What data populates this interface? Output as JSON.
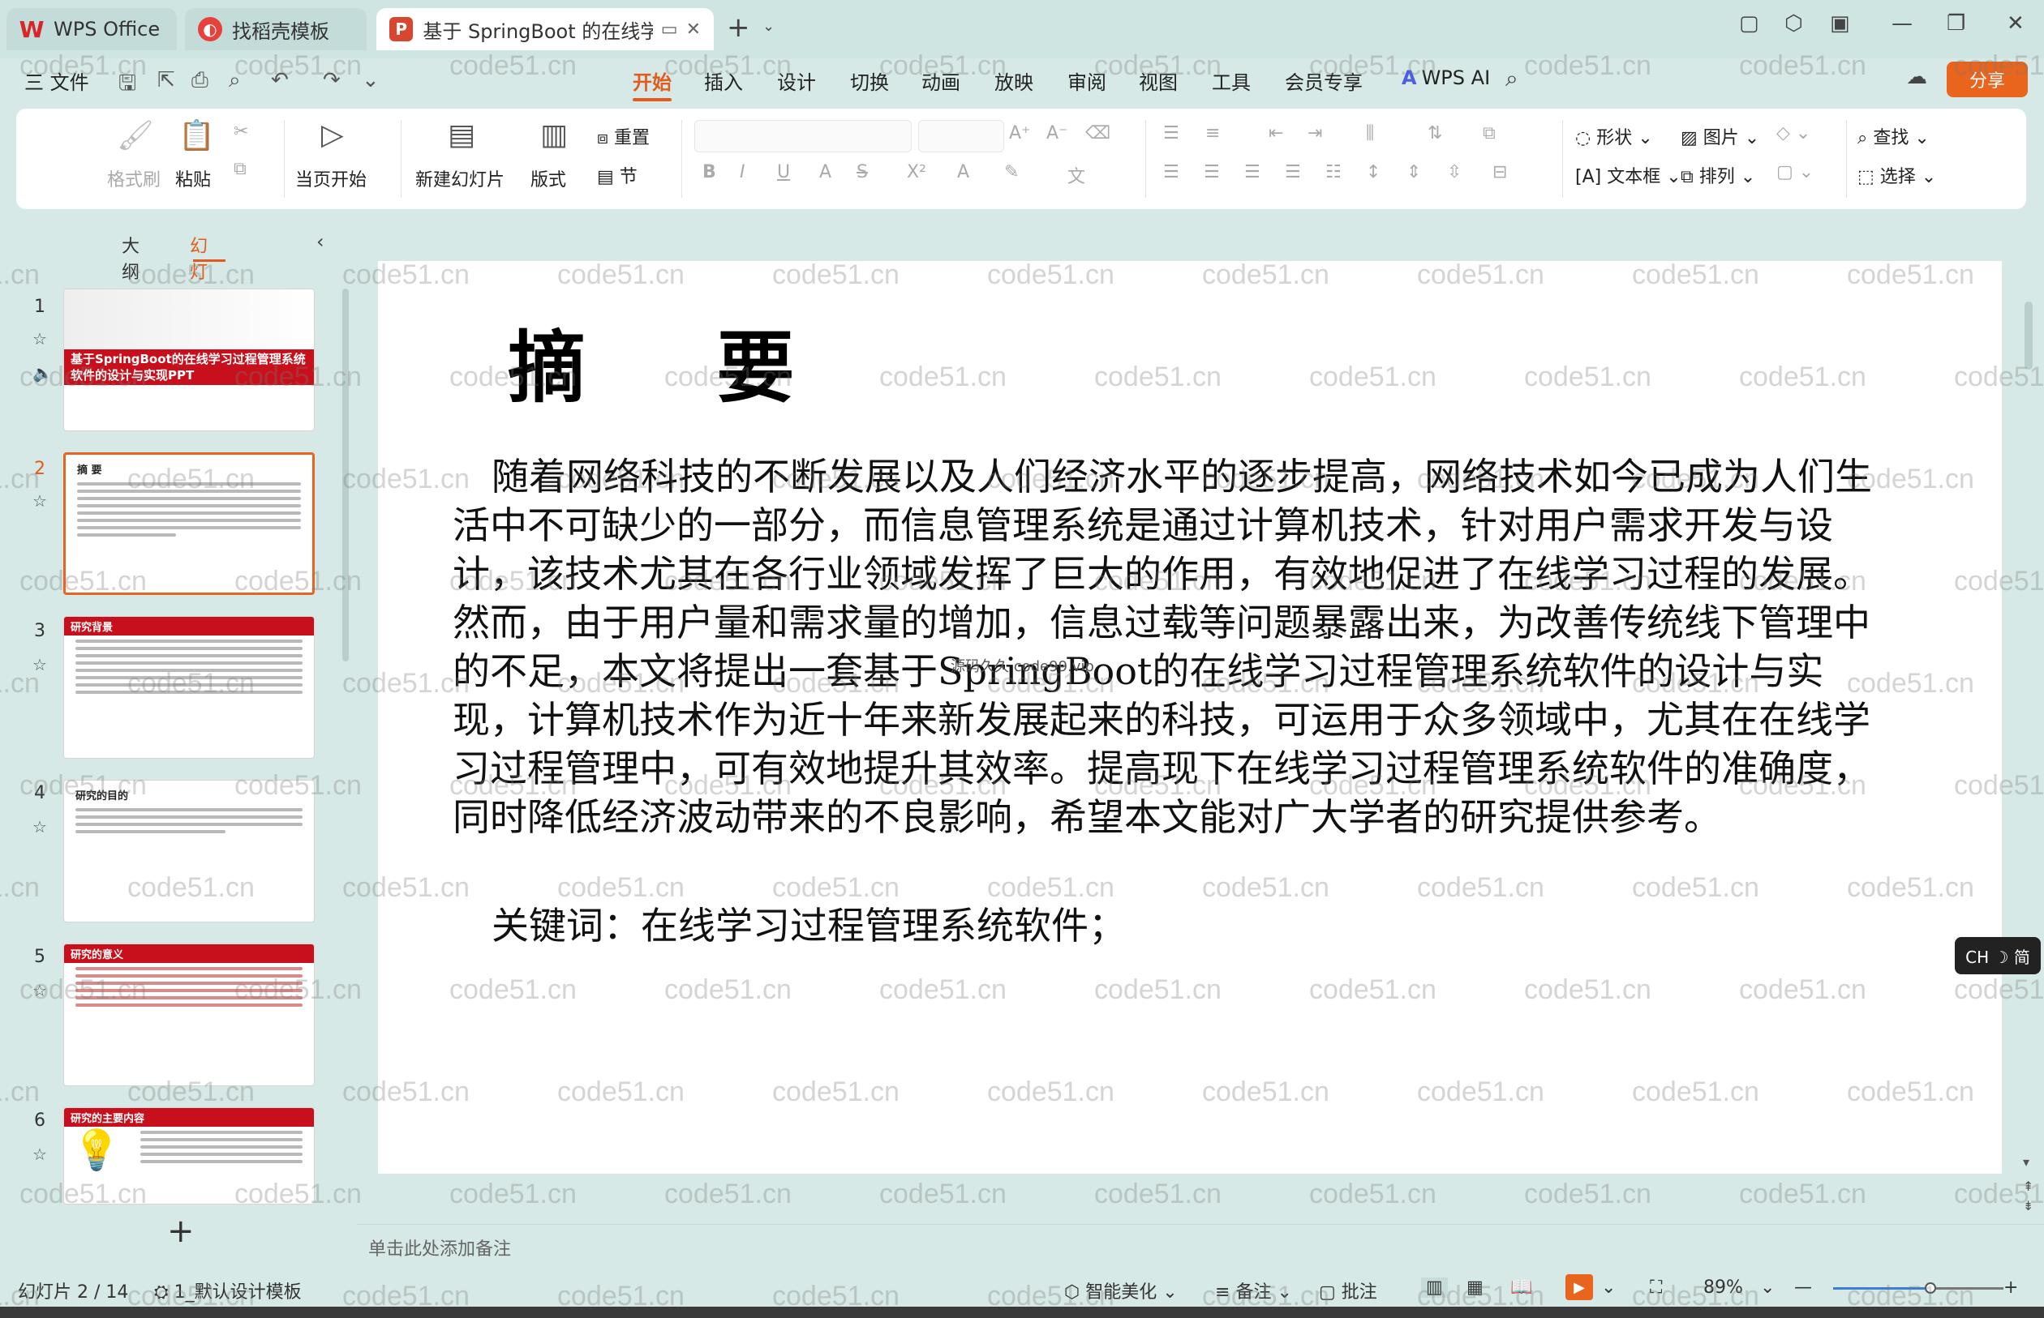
{
  "tabs": [
    {
      "label": "WPS Office",
      "icon": "wps-logo-icon"
    },
    {
      "label": "找稻壳模板",
      "icon": "docer-icon"
    },
    {
      "label": "基于 SpringBoot 的在线学习过程管理系统",
      "icon": "ppt-file-icon"
    }
  ],
  "menu": {
    "file": "三 文件",
    "ribbon_tabs": [
      "开始",
      "插入",
      "设计",
      "切换",
      "动画",
      "放映",
      "审阅",
      "视图",
      "工具",
      "会员专享"
    ],
    "active_tab": "开始",
    "wps_ai": "WPS AI",
    "share": "分享"
  },
  "ribbon": {
    "format_painter": "格式刷",
    "paste": "粘贴",
    "from_current": "当页开始",
    "new_slide": "新建幻灯片",
    "layout": "版式",
    "reset": "重置",
    "section": "节",
    "shape": "形状",
    "picture": "图片",
    "textbox": "文本框",
    "arrange": "排列",
    "find": "查找",
    "select": "选择"
  },
  "panel": {
    "outline_tab": "大纲",
    "slides_tab": "幻灯片",
    "slides": [
      {
        "num": "1",
        "title": "基于SpringBoot的在线学习过程管理系统软件的设计与实现PPT",
        "active": false
      },
      {
        "num": "2",
        "title": "摘  要",
        "active": true
      },
      {
        "num": "3",
        "title": "研究背景",
        "active": false
      },
      {
        "num": "4",
        "title": "研究的目的",
        "active": false
      },
      {
        "num": "5",
        "title": "研究的意义",
        "active": false
      },
      {
        "num": "6",
        "title": "研究的主要内容",
        "active": false
      }
    ]
  },
  "slide": {
    "title": "摘 要",
    "body": "随着网络科技的不断发展以及人们经济水平的逐步提高，网络技术如今已成为人们生活中不可缺少的一部分，而信息管理系统是通过计算机技术，针对用户需求开发与设计，该技术尤其在各行业领域发挥了巨大的作用，有效地促进了在线学习过程的发展。然而，由于用户量和需求量的增加，信息过载等问题暴露出来，为改善传统线下管理中的不足，本文将提出一套基于SpringBoot的在线学习过程管理系统软件的设计与实现，计算机技术作为近十年来新发展起来的科技，可运用于众多领域中，尤其在在线学习过程管理中，可有效地提升其效率。提高现下在线学习过程管理系统软件的准确度，同时降低经济波动带来的不良影响，希望本文能对广大学者的研究提供参考。",
    "keywords": "关键词：在线学习过程管理系统软件；",
    "stamp": "源码久久 code99.vip"
  },
  "ime": "CH ☽ 简",
  "notes_placeholder": "单击此处添加备注",
  "status": {
    "slide_counter": "幻灯片 2 / 14",
    "template": "1_默认设计模板",
    "beautify": "智能美化",
    "notes": "备注",
    "comments": "批注",
    "zoom": "89%",
    "zoom_level": 0.57
  },
  "watermark": "code51.cn",
  "colors": {
    "accent": "#e25a1c",
    "share": "#e9641c",
    "slide_red": "#c8101d"
  }
}
